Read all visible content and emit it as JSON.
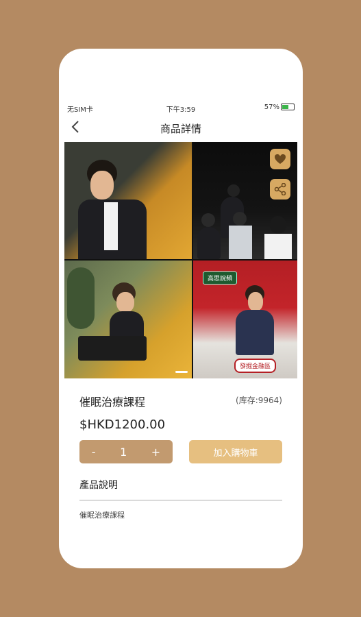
{
  "status": {
    "carrier": "无SIM卡",
    "time": "下午3:59",
    "battery": "57%"
  },
  "nav": {
    "title": "商品詳情"
  },
  "gallery": {
    "tag_text": "高思說頻",
    "banner_text": "發掘金融區"
  },
  "product": {
    "name": "催眠治療課程",
    "stock": "(库存:9964)",
    "price": "$HKD1200.00",
    "quantity": "1",
    "minus": "-",
    "plus": "+",
    "add_to_cart": "加入購物車",
    "description_heading": "產品說明",
    "description": "催眠治療課程"
  },
  "colors": {
    "accent": "#c29a6f",
    "cart": "#e6bf80",
    "background": "#b48a62"
  },
  "icons": {
    "back": "chevron-left-icon",
    "favorite": "heart-icon",
    "share": "share-icon"
  }
}
